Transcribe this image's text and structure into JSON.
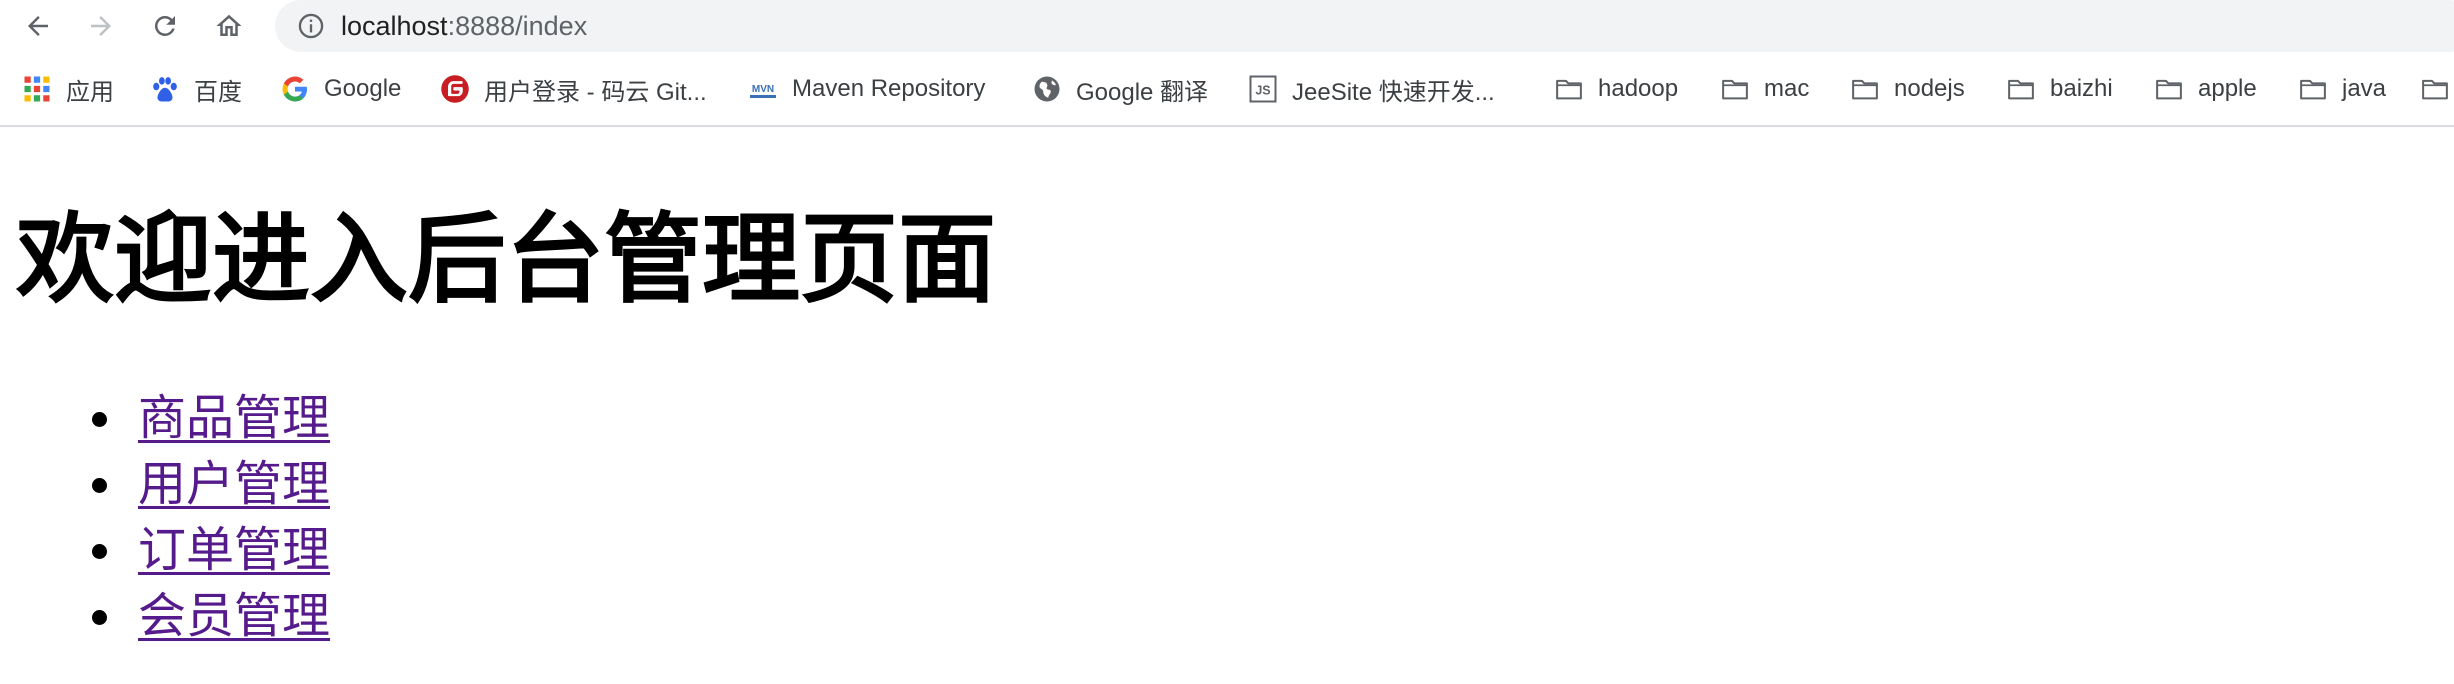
{
  "browser": {
    "url_host": "localhost",
    "url_rest": ":8888/index",
    "bookmarks": [
      {
        "label": "应用",
        "icon": "apps-grid-icon"
      },
      {
        "label": "百度",
        "icon": "baidu-icon"
      },
      {
        "label": "Google",
        "icon": "google-icon"
      },
      {
        "label": "用户登录 - 码云 Git...",
        "icon": "gitee-icon"
      },
      {
        "label": "Maven Repository",
        "icon": "maven-icon"
      },
      {
        "label": "Google 翻译",
        "icon": "globe-icon"
      },
      {
        "label": "JeeSite 快速开发...",
        "icon": "js-icon"
      },
      {
        "label": "hadoop",
        "icon": "folder-icon"
      },
      {
        "label": "mac",
        "icon": "folder-icon"
      },
      {
        "label": "nodejs",
        "icon": "folder-icon"
      },
      {
        "label": "baizhi",
        "icon": "folder-icon"
      },
      {
        "label": "apple",
        "icon": "folder-icon"
      },
      {
        "label": "java",
        "icon": "folder-icon"
      }
    ]
  },
  "page": {
    "title": "欢迎进入后台管理页面",
    "menu": [
      {
        "label": "商品管理"
      },
      {
        "label": "用户管理"
      },
      {
        "label": "订单管理"
      },
      {
        "label": "会员管理"
      }
    ]
  },
  "colors": {
    "link_visited": "#551a8b",
    "omnibox_bg": "#f1f3f4"
  }
}
